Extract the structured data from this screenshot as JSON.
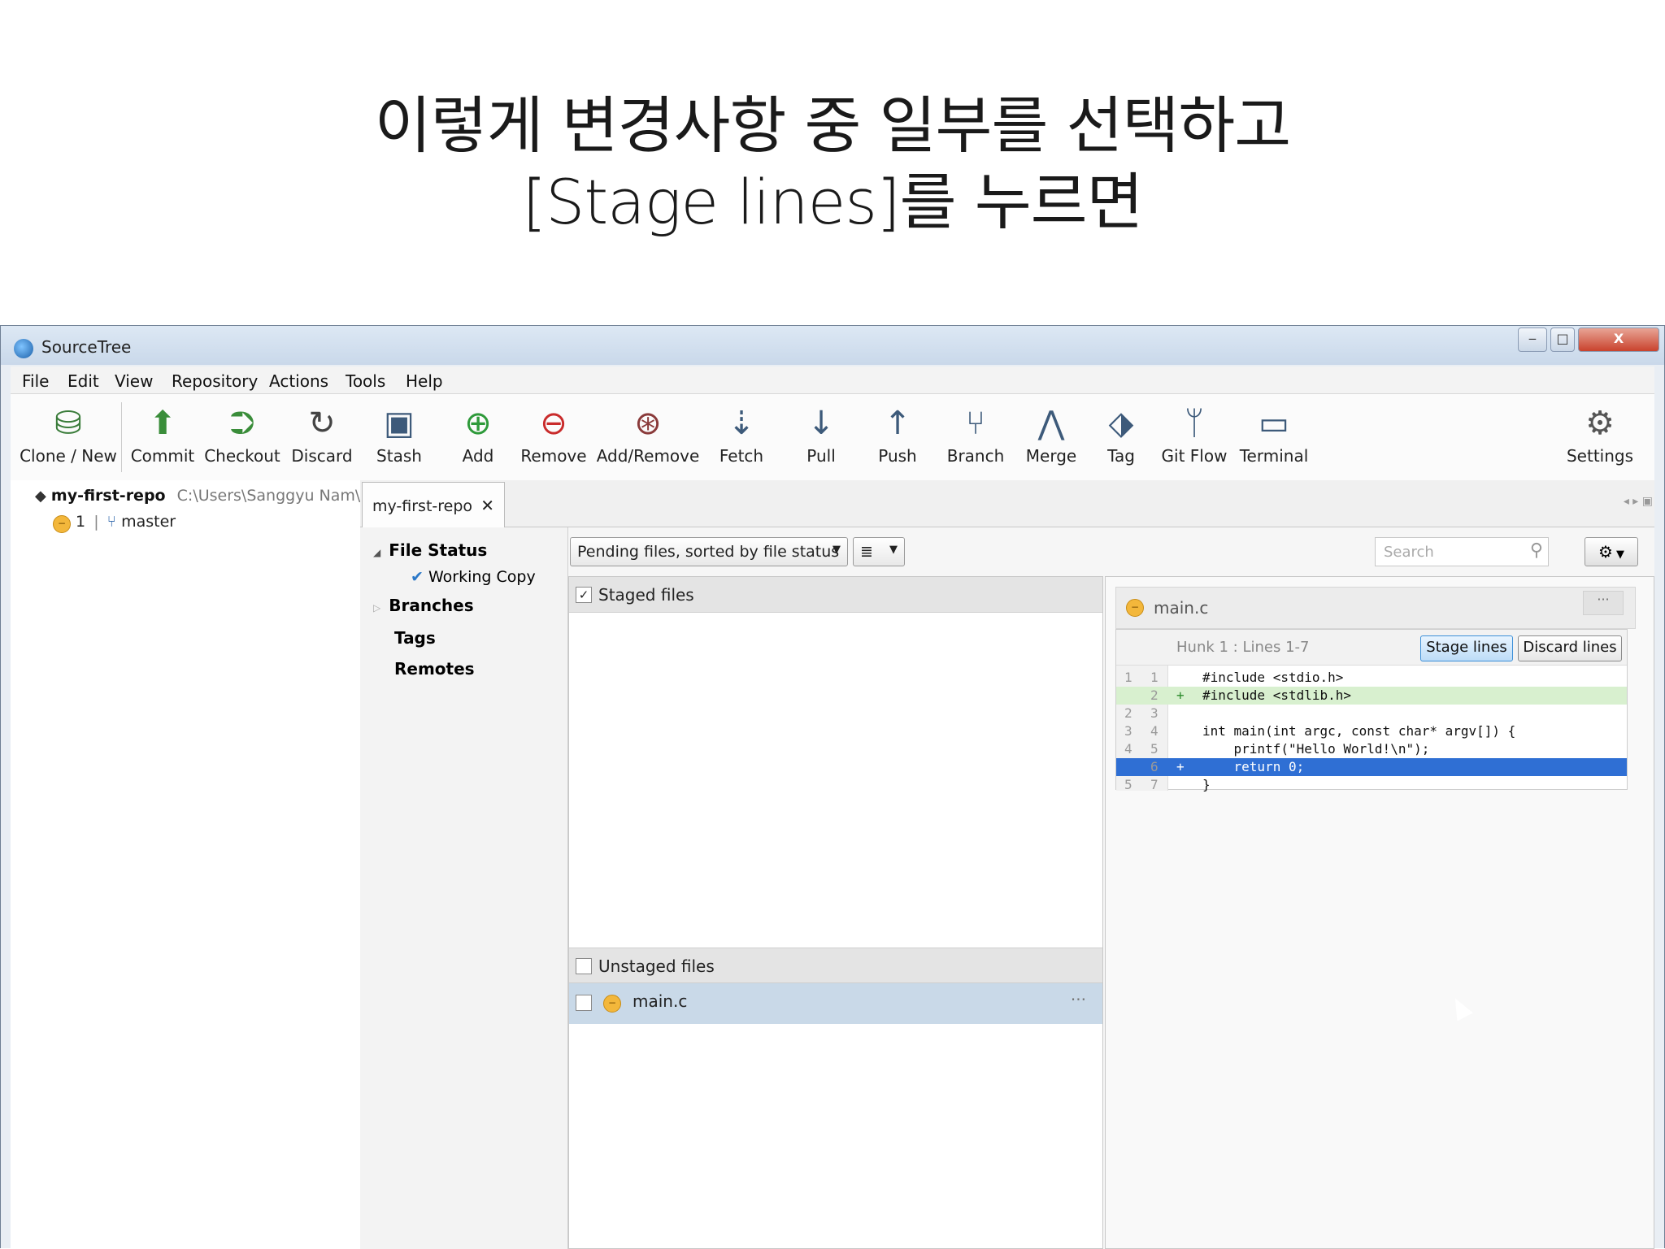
{
  "caption": {
    "line1": "이렇게 변경사항 중 일부를 선택하고",
    "line2": "[Stage lines]를 누르면"
  },
  "window": {
    "title": "SourceTree",
    "controls": {
      "minimize": "‒",
      "maximize": "□",
      "close": "X"
    }
  },
  "menu": [
    "File",
    "Edit",
    "View",
    "Repository",
    "Actions",
    "Tools",
    "Help"
  ],
  "toolbar": [
    {
      "label": "Clone / New",
      "icon": "database-plus-icon"
    },
    {
      "label": "Commit",
      "icon": "commit-icon"
    },
    {
      "label": "Checkout",
      "icon": "checkout-icon"
    },
    {
      "label": "Discard",
      "icon": "discard-icon"
    },
    {
      "label": "Stash",
      "icon": "stash-box-icon"
    },
    {
      "label": "Add",
      "icon": "add-file-icon"
    },
    {
      "label": "Remove",
      "icon": "remove-file-icon"
    },
    {
      "label": "Add/Remove",
      "icon": "add-remove-icon"
    },
    {
      "label": "Fetch",
      "icon": "fetch-arrow-icon"
    },
    {
      "label": "Pull",
      "icon": "pull-arrow-icon"
    },
    {
      "label": "Push",
      "icon": "push-arrow-icon"
    },
    {
      "label": "Branch",
      "icon": "branch-icon"
    },
    {
      "label": "Merge",
      "icon": "merge-icon"
    },
    {
      "label": "Tag",
      "icon": "tag-icon"
    },
    {
      "label": "Git Flow",
      "icon": "git-flow-icon"
    },
    {
      "label": "Terminal",
      "icon": "terminal-icon"
    },
    {
      "label": "Settings",
      "icon": "gear-icon"
    }
  ],
  "repo": {
    "name": "my-first-repo",
    "path": "C:\\Users\\Sanggyu Nam\\r",
    "pending_count": "1",
    "branch": "master"
  },
  "tab": {
    "label": "my-first-repo",
    "close": "✕"
  },
  "sidebar": {
    "file_status": "File Status",
    "working_copy": "Working Copy",
    "branches": "Branches",
    "tags": "Tags",
    "remotes": "Remotes"
  },
  "filter": {
    "sort_label": "Pending files, sorted by file status",
    "search_placeholder": "Search"
  },
  "staged": {
    "header": "Staged files",
    "checked": "✓"
  },
  "unstaged": {
    "header": "Unstaged files",
    "files": [
      {
        "name": "main.c",
        "more": "···"
      }
    ]
  },
  "diff": {
    "file": "main.c",
    "more": "···",
    "hunk_title": "Hunk 1 : Lines 1-7",
    "stage_lines_label": "Stage lines",
    "discard_lines_label": "Discard lines",
    "lines": [
      {
        "old": "1",
        "new": "1",
        "mark": "",
        "text": "#include <stdio.h>",
        "state": "context"
      },
      {
        "old": "",
        "new": "2",
        "mark": "+",
        "text": "#include <stdlib.h>",
        "state": "added"
      },
      {
        "old": "2",
        "new": "3",
        "mark": "",
        "text": "",
        "state": "context"
      },
      {
        "old": "3",
        "new": "4",
        "mark": "",
        "text": "int main(int argc, const char* argv[]) {",
        "state": "context"
      },
      {
        "old": "4",
        "new": "5",
        "mark": "",
        "text": "    printf(\"Hello World!\\n\");",
        "state": "context"
      },
      {
        "old": "",
        "new": "6",
        "mark": "+",
        "text": "    return 0;",
        "state": "selected"
      },
      {
        "old": "5",
        "new": "7",
        "mark": "",
        "text": "}",
        "state": "context"
      }
    ]
  },
  "colors": {
    "added_line": "#d8f0cf",
    "selected_line": "#2f6fd4",
    "modified_badge": "#f3b73b"
  }
}
